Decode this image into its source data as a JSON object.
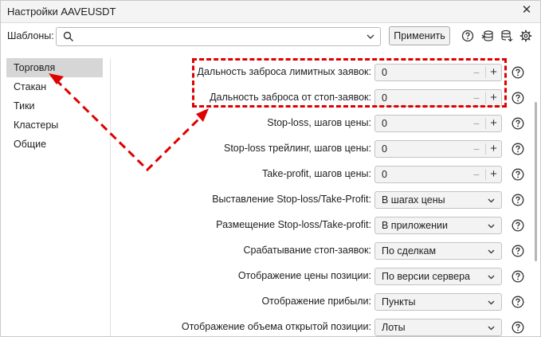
{
  "window": {
    "title": "Настройки AAVEUSDT"
  },
  "templates": {
    "label": "Шаблоны:",
    "search_value": "",
    "apply_label": "Применить"
  },
  "sidebar": {
    "items": [
      {
        "label": "Торговля",
        "active": true
      },
      {
        "label": "Стакан"
      },
      {
        "label": "Тики"
      },
      {
        "label": "Кластеры"
      },
      {
        "label": "Общие"
      }
    ]
  },
  "settings": [
    {
      "label": "Дальность заброса лимитных заявок:",
      "type": "number",
      "value": "0"
    },
    {
      "label": "Дальность заброса от стоп-заявок:",
      "type": "number",
      "value": "0"
    },
    {
      "label": "Stop-loss, шагов цены:",
      "type": "number",
      "value": "0"
    },
    {
      "label": "Stop-loss трейлинг, шагов цены:",
      "type": "number",
      "value": "0"
    },
    {
      "label": "Take-profit, шагов цены:",
      "type": "number",
      "value": "0"
    },
    {
      "label": "Выставление Stop-loss/Take-Profit:",
      "type": "select",
      "value": "В шагах цены"
    },
    {
      "label": "Размещение Stop-loss/Take-profit:",
      "type": "select",
      "value": "В приложении"
    },
    {
      "label": "Срабатывание стоп-заявок:",
      "type": "select",
      "value": "По сделкам"
    },
    {
      "label": "Отображение цены позиции:",
      "type": "select",
      "value": "По версии сервера"
    },
    {
      "label": "Отображение прибыли:",
      "type": "select",
      "value": "Пункты"
    },
    {
      "label": "Отображение объема открытой позиции:",
      "type": "select",
      "value": "Лоты"
    }
  ],
  "colors": {
    "annotation": "#e00000",
    "active_item": "#d6d6d6"
  }
}
